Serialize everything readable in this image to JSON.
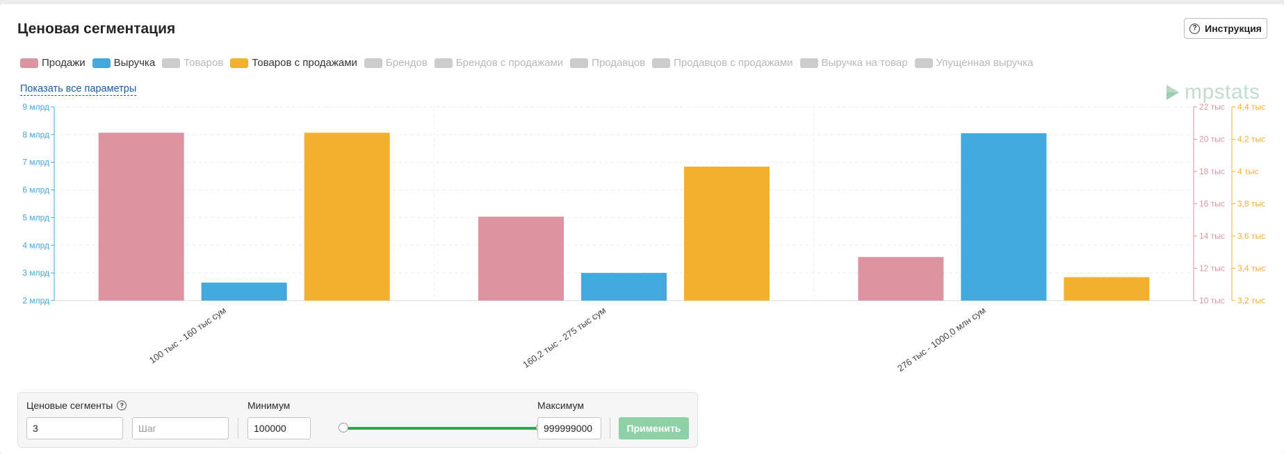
{
  "header": {
    "title": "Ценовая сегментация",
    "instruction_label": "Инструкция",
    "instruction_icon": "question-circle-icon"
  },
  "legend": [
    {
      "label": "Продажи",
      "color": "#dc95a0",
      "active": true
    },
    {
      "label": "Выручка",
      "color": "#43a8dc",
      "active": true
    },
    {
      "label": "Товаров",
      "color": "#cccccc",
      "active": false
    },
    {
      "label": "Товаров с продажами",
      "color": "#f2b02e",
      "active": true
    },
    {
      "label": "Брендов",
      "color": "#cccccc",
      "active": false
    },
    {
      "label": "Брендов с продажами",
      "color": "#cccccc",
      "active": false
    },
    {
      "label": "Продавцов",
      "color": "#cccccc",
      "active": false
    },
    {
      "label": "Продавцов с продажами",
      "color": "#cccccc",
      "active": false
    },
    {
      "label": "Выручка на товар",
      "color": "#cccccc",
      "active": false
    },
    {
      "label": "Упущенная выручка",
      "color": "#cccccc",
      "active": false
    }
  ],
  "show_all_link": "Показать все параметры",
  "logo_text": "mpstats",
  "colors": {
    "sales": "#dc95a0",
    "revenue": "#43a8dc",
    "items_with_sales": "#f2b02e",
    "apply": "#8fd1a6",
    "slider": "#2ea44f"
  },
  "chart_data": {
    "type": "bar",
    "categories": [
      "100 тыс - 160 тыс сум",
      "160,2 тыс - 275 тыс сум",
      "276 тыс - 1000,0 млн сум"
    ],
    "series": [
      {
        "name": "Продажи",
        "axis": "right_sales",
        "color": "#dc95a0",
        "values": [
          20400,
          15200,
          12700
        ]
      },
      {
        "name": "Выручка",
        "axis": "left_revenue",
        "color": "#43a8dc",
        "values": [
          2650000000,
          3000000000,
          8050000000
        ]
      },
      {
        "name": "Товаров с продажами",
        "axis": "right_items",
        "color": "#f2b02e",
        "values": [
          4240,
          4030,
          3345
        ]
      }
    ],
    "axes": {
      "left_revenue": {
        "min": 2000000000,
        "max": 9000000000,
        "ticks": [
          "2 млрд",
          "3 млрд",
          "4 млрд",
          "5 млрд",
          "6 млрд",
          "7 млрд",
          "8 млрд",
          "9 млрд"
        ],
        "color": "#43a8dc"
      },
      "right_sales": {
        "min": 10000,
        "max": 22000,
        "ticks": [
          "10 тыс",
          "12 тыс",
          "14 тыс",
          "16 тыс",
          "18 тыс",
          "20 тыс",
          "22 тыс"
        ],
        "color": "#dc95a0"
      },
      "right_items": {
        "min": 3200,
        "max": 4400,
        "ticks": [
          "3,2 тыс",
          "3,4 тыс",
          "3,6 тыс",
          "3,8 тыс",
          "4 тыс",
          "4,2 тыс",
          "4,4 тыс"
        ],
        "color": "#f2b02e"
      }
    },
    "grid": true
  },
  "filters": {
    "segments_label": "Ценовые сегменты",
    "segments_value": "3",
    "step_placeholder": "Шаг",
    "min_label": "Минимум",
    "min_value": "100000",
    "max_label": "Максимум",
    "max_value": "999999000",
    "apply_label": "Применить",
    "slider_range": [
      0,
      1
    ]
  }
}
